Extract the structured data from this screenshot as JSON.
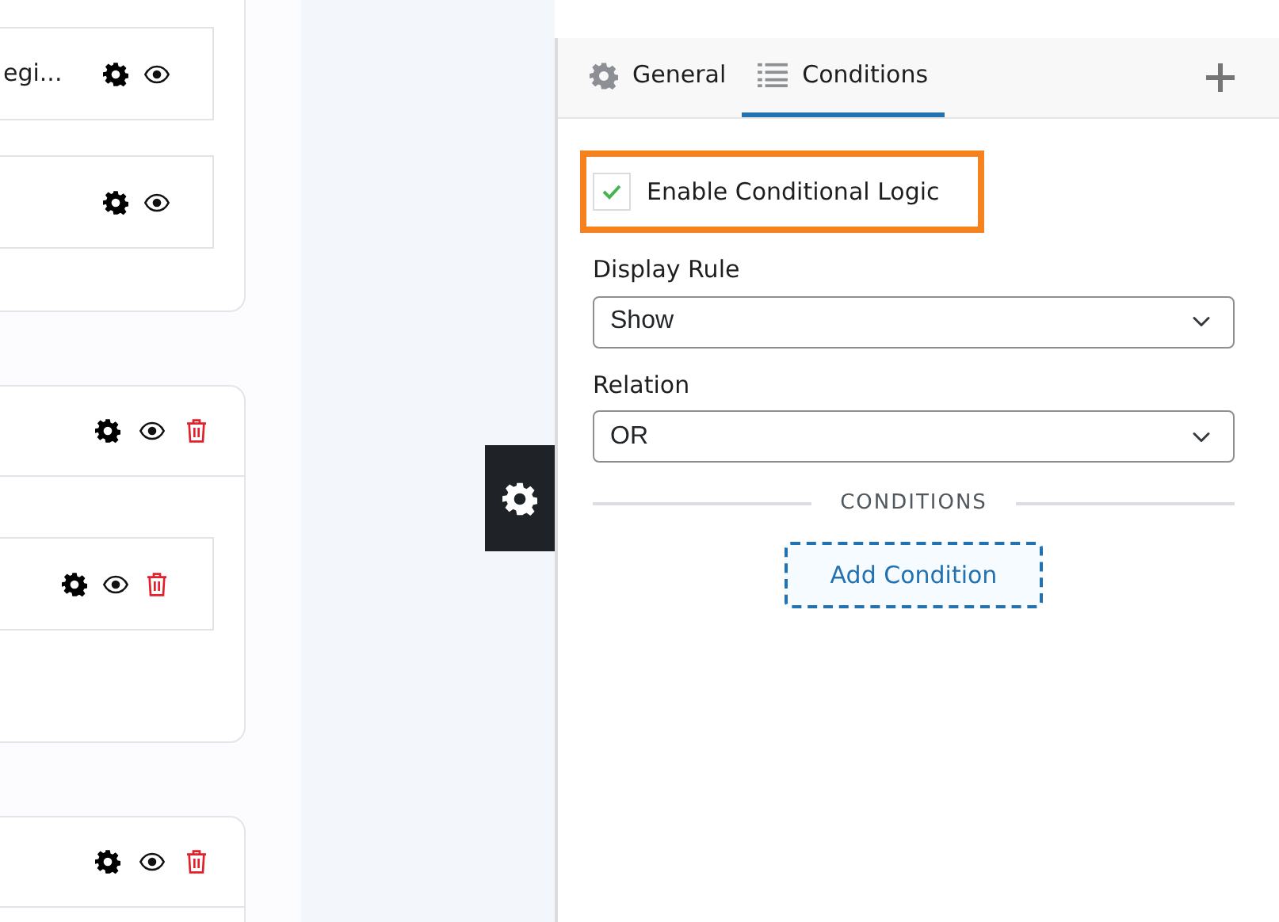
{
  "builder_cards": [
    {
      "header": false,
      "rows": [
        {
          "label": "egi...",
          "deletable": false
        },
        {
          "deletable": false
        }
      ]
    },
    {
      "header": true,
      "deletable": true,
      "rows": [
        {
          "deletable": true
        }
      ]
    },
    {
      "header": true,
      "deletable": true
    }
  ],
  "panel": {
    "tabs": [
      {
        "label": "General",
        "kind": "gear",
        "selected": false
      },
      {
        "label": "Conditions",
        "kind": "list",
        "selected": true
      }
    ],
    "enable_checkbox": {
      "label": "Enable Conditional Logic",
      "checked": true,
      "highlighted": true
    },
    "fields": [
      {
        "label": "Display Rule",
        "value": "Show"
      },
      {
        "label": "Relation",
        "value": "OR"
      }
    ],
    "divider": "CONDITIONS",
    "add_button": "Add Condition"
  }
}
